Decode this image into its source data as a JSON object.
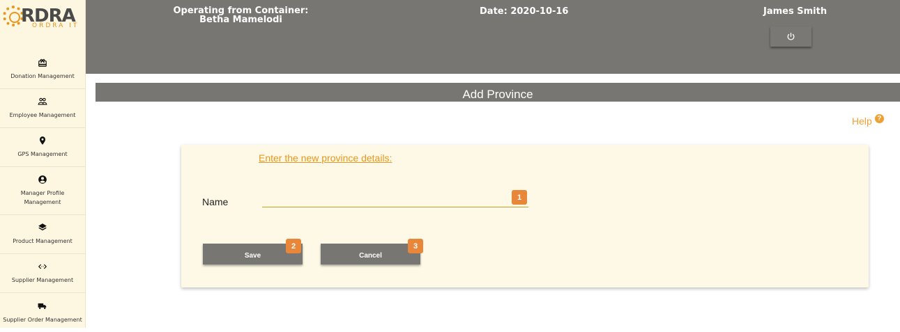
{
  "logo": {
    "text": "RDRA",
    "sub": "ORDRA IT"
  },
  "sidebar": {
    "items": [
      {
        "label": "Donation Management",
        "icon": "gift-icon"
      },
      {
        "label": "Employee Management",
        "icon": "people-icon"
      },
      {
        "label": "GPS Management",
        "icon": "location-pin-icon"
      },
      {
        "label": "Manager Profile Management",
        "icon": "account-circle-icon"
      },
      {
        "label": "Product Management",
        "icon": "layers-icon"
      },
      {
        "label": "Supplier Management",
        "icon": "code-arrows-icon"
      },
      {
        "label": "Supplier Order Management",
        "icon": "truck-icon"
      }
    ]
  },
  "header": {
    "operating_line1": "Operating from Container:",
    "operating_line2": "Betha Mamelodi",
    "date": "Date: 2020-10-16",
    "user": "James Smith",
    "power_icon": "power-icon"
  },
  "page": {
    "title": "Add Province",
    "help": "Help",
    "help_icon": "?"
  },
  "form": {
    "heading": "Enter the new province details:",
    "name_label": "Name",
    "name_value": "",
    "save_label": "Save",
    "cancel_label": "Cancel"
  },
  "badges": {
    "one": "1",
    "two": "2",
    "three": "3"
  },
  "colors": {
    "accent": "#e8961e",
    "bar": "#787672",
    "sidebar_bg": "#fdf6e0",
    "card_bg": "#fef9e6",
    "badge": "#e8873a"
  }
}
